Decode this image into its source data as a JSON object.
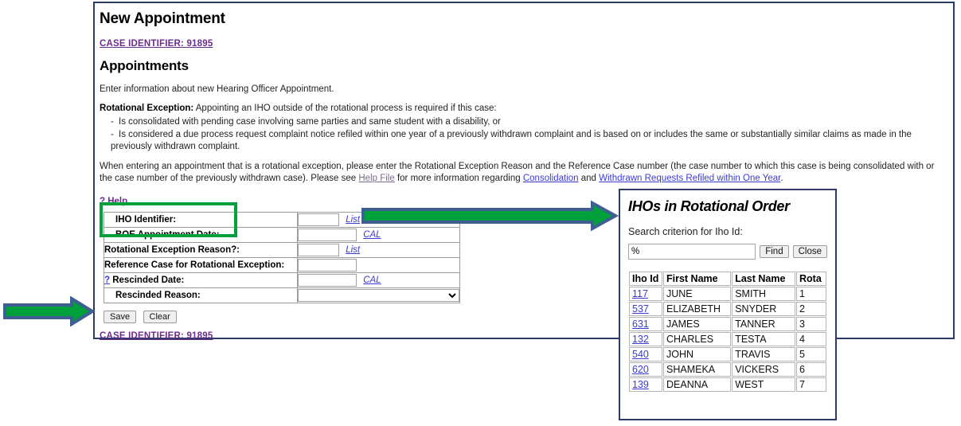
{
  "page": {
    "title": "New Appointment",
    "case_identifier_top": "CASE IDENTIFIER: 91895",
    "case_identifier_bottom": "CASE IDENTIFIER: 91895",
    "section_title": "Appointments",
    "intro": "Enter information about new Hearing Officer Appointment.",
    "rotational_lead": "Rotational Exception:",
    "rotational_rest": " Appointing an IHO outside of the rotational process is required if this case:",
    "bullet1": "Is consolidated with pending case involving same parties and same student with a disability, or",
    "bullet2": "Is considered a due process request complaint notice refiled within one year of a previously withdrawn complaint and is based on or includes the same or substantially similar claims as made in the previously withdrawn complaint.",
    "para_pre": "When entering an appointment that is a rotational exception, please enter the Rotational Exception Reason and the Reference Case number (the case number to which this case is being consolidated with or the case number of the previously withdrawn case). Please see ",
    "link_help_file": "Help File",
    "para_mid": " for more information regarding ",
    "link_consolidation": "Consolidation",
    "para_and": " and ",
    "link_withdrawn": "Withdrawn Requests Refiled within One Year",
    "para_end": ".",
    "help_link": "? Help"
  },
  "form": {
    "rows": [
      {
        "label": "IHO Identifier:",
        "value": "",
        "link": "List",
        "input_width": "w-narrow",
        "control": "text-link"
      },
      {
        "label": "BOE Appointment Date:",
        "value": "",
        "link": "CAL",
        "input_width": "w-mid",
        "control": "text-link"
      },
      {
        "label": "Rotational Exception Reason?:",
        "value": "",
        "link": "List",
        "input_width": "w-wide",
        "control": "text-link"
      },
      {
        "label": "Reference Case for Rotational Exception:",
        "value": "",
        "link": "",
        "input_width": "w-mid",
        "control": "text"
      },
      {
        "label": "? Rescinded Date:",
        "value": "",
        "link": "CAL",
        "input_width": "w-mid",
        "control": "text-link"
      },
      {
        "label": "Rescinded Reason:",
        "value": "",
        "link": "",
        "input_width": "",
        "control": "select"
      }
    ],
    "rescinded_reason_selected": "",
    "save_label": "Save",
    "clear_label": "Clear"
  },
  "popup": {
    "title": "IHOs in Rotational Order",
    "search_label": "Search criterion for Iho Id:",
    "search_value": "%",
    "find_label": "Find",
    "close_label": "Close",
    "columns": [
      "Iho Id",
      "First Name",
      "Last Name",
      "Rota"
    ],
    "rows": [
      {
        "id": "117",
        "first": "JUNE",
        "last": "SMITH",
        "rota": "1"
      },
      {
        "id": "537",
        "first": "ELIZABETH",
        "last": "SNYDER",
        "rota": "2"
      },
      {
        "id": "631",
        "first": "JAMES",
        "last": "TANNER",
        "rota": "3"
      },
      {
        "id": "132",
        "first": "CHARLES",
        "last": "TESTA",
        "rota": "4"
      },
      {
        "id": "540",
        "first": "JOHN",
        "last": "TRAVIS",
        "rota": "5"
      },
      {
        "id": "620",
        "first": "SHAMEKA",
        "last": "VICKERS",
        "rota": "6"
      },
      {
        "id": "139",
        "first": "DEANNA",
        "last": "WEST",
        "rota": "7"
      }
    ]
  },
  "annotations": {
    "highlight_color": "#00a03c",
    "arrow_fill": "#00a03c",
    "arrow_outline": "#3f5e92",
    "frame_border": "#2b3a67"
  }
}
